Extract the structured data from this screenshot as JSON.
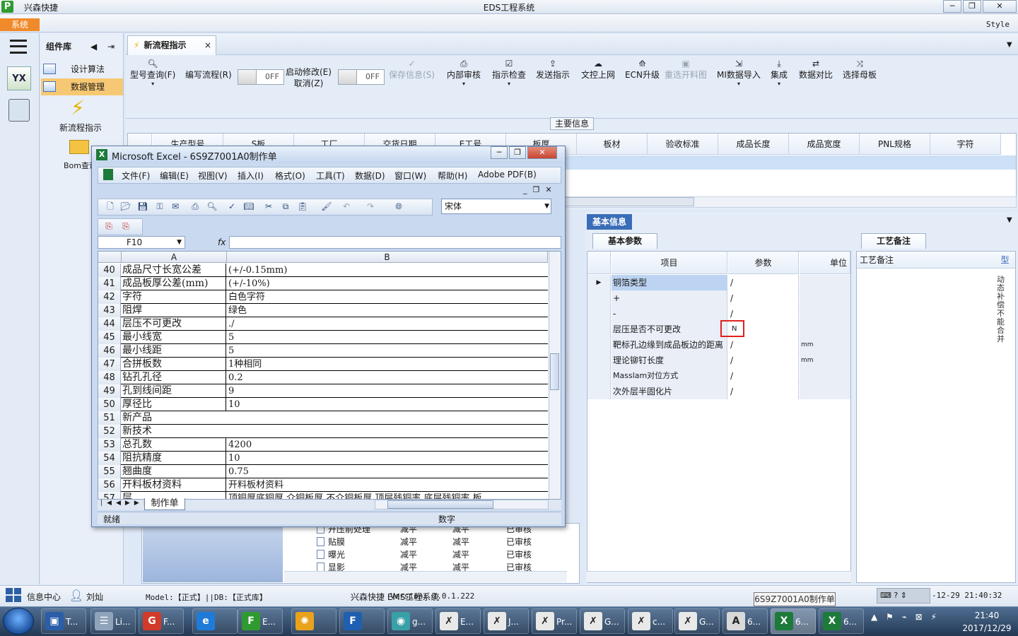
{
  "window": {
    "app_name": "兴森快捷",
    "title": "EDS工程系统",
    "buttons": [
      "─",
      "❐",
      "✕"
    ]
  },
  "sysbar": {
    "system_tab": "系统",
    "style_label": "Style"
  },
  "complib": {
    "title": "组件库",
    "items": [
      "设计算法",
      "数据管理"
    ],
    "new_flow": "新流程指示",
    "bom_query": "Bom查询"
  },
  "doc_tab": {
    "label": "新流程指示",
    "close": "×"
  },
  "toolbar": {
    "model_query": "型号查询(F)",
    "write_flow": "编写流程(R)",
    "toggle1": "OFF",
    "start_modify_l1": "启动修改(E)",
    "start_modify_l2": "取消(Z)",
    "toggle2": "OFF",
    "save_info": "保存信息(S)",
    "internal_review": "内部审核",
    "check_instruction": "指示检查",
    "send_instruction": "发送指示",
    "doc_upload": "文控上网",
    "ecn_upgrade": "ECN升级",
    "reselect_drawing": "重选开料图",
    "mi_import": "MI数据导入",
    "integrate": "集成",
    "data_compare": "数据对比",
    "select_mother": "选择母板"
  },
  "main_info": {
    "label": "主要信息",
    "columns": [
      "生产型号",
      "S板",
      "工厂",
      "交货日期",
      "E工号",
      "板厚",
      "板材",
      "验收标准",
      "成品长度",
      "成品宽度",
      "PNL规格",
      "字符"
    ]
  },
  "basic_info": {
    "tab": "基本信息",
    "param_tab": "基本参数",
    "columns": [
      "项目",
      "参数",
      "单位"
    ],
    "rows": [
      {
        "item": "铜箔类型",
        "value": "/",
        "unit": ""
      },
      {
        "item": "+",
        "value": "/",
        "unit": ""
      },
      {
        "item": "-",
        "value": "/",
        "unit": ""
      },
      {
        "item": "层压是否不可更改",
        "value": "N",
        "unit": ""
      },
      {
        "item": "靶标孔边缘到成品板边的距离",
        "value": "/",
        "unit": "mm"
      },
      {
        "item": "理论铆钉长度",
        "value": "/",
        "unit": "mm"
      },
      {
        "item": "Masslam对位方式",
        "value": "/",
        "unit": ""
      },
      {
        "item": "次外层半固化片",
        "value": "/",
        "unit": ""
      }
    ]
  },
  "craft": {
    "tab": "工艺备注",
    "header": "工艺备注",
    "col2": "型",
    "vertical_text": "动态补偿不能合并"
  },
  "tree": {
    "rows": [
      {
        "name": "开压前处理",
        "c1": "减平",
        "c2": "减平",
        "c3": "已审核"
      },
      {
        "name": "贴膜",
        "c1": "减平",
        "c2": "减平",
        "c3": "已审核"
      },
      {
        "name": "曝光",
        "c1": "减平",
        "c2": "减平",
        "c3": "已审核"
      },
      {
        "name": "显影",
        "c1": "减平",
        "c2": "减平",
        "c3": "已审核"
      }
    ]
  },
  "excel": {
    "title": "Microsoft Excel - 6S9Z7001A0制作单",
    "menus": [
      "文件(F)",
      "编辑(E)",
      "视图(V)",
      "插入(I)",
      "格式(O)",
      "工具(T)",
      "数据(D)",
      "窗口(W)",
      "帮助(H)",
      "Adobe PDF(B)"
    ],
    "font": "宋体",
    "namebox": "F10",
    "fx": "fx",
    "col_a": "A",
    "col_b": "B",
    "rows": [
      {
        "n": "40",
        "a": "成品尺寸长宽公差",
        "b": "(+/-0.15mm)"
      },
      {
        "n": "41",
        "a": "成品板厚公差(mm)",
        "b": "(+/-10%)"
      },
      {
        "n": "42",
        "a": "字符",
        "b": "白色字符"
      },
      {
        "n": "43",
        "a": "阻焊",
        "b": "绿色"
      },
      {
        "n": "44",
        "a": "层压不可更改",
        "b": "./"
      },
      {
        "n": "45",
        "a": "最小线宽",
        "b": "5"
      },
      {
        "n": "46",
        "a": "最小线距",
        "b": "5"
      },
      {
        "n": "47",
        "a": "合拼板数",
        "b": "1种相同"
      },
      {
        "n": "48",
        "a": "钻孔孔径",
        "b": "0.2"
      },
      {
        "n": "49",
        "a": "孔到线间距",
        "b": "9"
      },
      {
        "n": "50",
        "a": "厚径比",
        "b": "10"
      },
      {
        "n": "51",
        "a": "新产品",
        "b": ""
      },
      {
        "n": "52",
        "a": "新技术",
        "b": ""
      },
      {
        "n": "53",
        "a": "总孔数",
        "b": "4200"
      },
      {
        "n": "54",
        "a": "阻抗精度",
        "b": "10"
      },
      {
        "n": "55",
        "a": "翘曲度",
        "b": "0.75"
      },
      {
        "n": "56",
        "a": "开料板材资料",
        "b": "开料板材资料"
      },
      {
        "n": "57",
        "a": "层",
        "b": "顶铜厚底铜厚 介铜板厚 不介铜板厚 顶层残铜率 底层残铜率 板"
      }
    ],
    "sheet_tab": "制作单",
    "status_ready": "就绪",
    "status_num": "数字"
  },
  "statusbar": {
    "info_center": "信息中心",
    "user": "刘灿",
    "model": "Model:【正式】||DB:【正式库】",
    "sysname": "兴森快捷 EMS工程系统",
    "version": "Version: 1.0.1.222",
    "tooltip": "6S9Z7001A0制作单",
    "datetime": "-12-29 21:40:32"
  },
  "taskbar": {
    "buttons": [
      "T...",
      "Li...",
      "F...",
      "",
      "E...",
      "",
      "",
      "g...",
      "E...",
      "J...",
      "Pr...",
      "G...",
      "c...",
      "G...",
      "6...",
      "6...",
      "6..."
    ],
    "time": "21:40",
    "date": "2017/12/29"
  }
}
